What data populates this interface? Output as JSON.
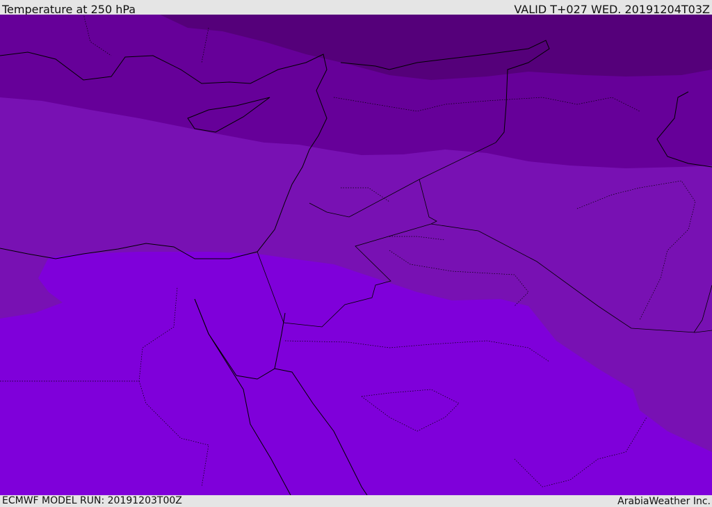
{
  "header": {
    "title": "Temperature at 250 hPa",
    "valid": "VALID T+027 WED. 20191204T03Z"
  },
  "footer": {
    "model_run": "ECMWF MODEL RUN: 20191203T00Z",
    "credit": "ArabiaWeather Inc."
  },
  "colors": {
    "band1": "#55007a",
    "band2": "#660099",
    "band3": "#7811b3",
    "band4": "#7f00da"
  }
}
